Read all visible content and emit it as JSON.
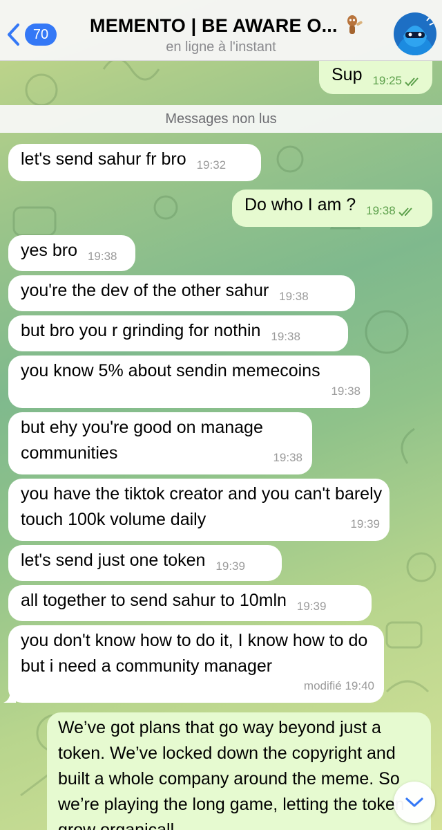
{
  "header": {
    "back_count": "70",
    "title": "MEMENTO | BE AWARE O...",
    "status": "en ligne à l'instant"
  },
  "unread_label": "Messages non lus",
  "messages": [
    {
      "dir": "out",
      "text": "Sup",
      "time": "19:25",
      "read": true
    },
    {
      "dir": "in",
      "text": "let's send sahur fr bro",
      "time": "19:32"
    },
    {
      "dir": "out",
      "text": "Do who I am ?",
      "time": "19:38",
      "read": true
    },
    {
      "dir": "in",
      "text": "yes bro",
      "time": "19:38"
    },
    {
      "dir": "in",
      "text": "you're the dev of the other sahur",
      "time": "19:38"
    },
    {
      "dir": "in",
      "text": "but bro you r grinding for nothin",
      "time": "19:38"
    },
    {
      "dir": "in",
      "text": "you know 5% about sendin memecoins",
      "time": "19:38"
    },
    {
      "dir": "in",
      "text": "but ehy you're good on manage communities",
      "time": "19:38"
    },
    {
      "dir": "in",
      "text": "you have the tiktok creator and you can't barely touch 100k volume daily",
      "time": "19:39"
    },
    {
      "dir": "in",
      "text": "let's send just one token",
      "time": "19:39"
    },
    {
      "dir": "in",
      "text": "all together to send sahur to 10mln",
      "time": "19:39"
    },
    {
      "dir": "in",
      "text": "you don't know how to do it, I know how to do but i need a community manager",
      "time": "modifié 19:40"
    },
    {
      "dir": "out",
      "text": "We’ve got plans that go way beyond just a token. We’ve locked down the copyright and built a whole company around the meme. So we’re playing the long game, letting the token grow organicall"
    }
  ],
  "icons": {
    "back": "chevron-left-icon",
    "read": "double-check-icon",
    "scroll": "chevron-down-icon"
  },
  "colors": {
    "accent": "#3478f6",
    "outgoing_bubble": "#e6fad0",
    "incoming_bubble": "#ffffff",
    "read_check": "#5ca04b"
  }
}
